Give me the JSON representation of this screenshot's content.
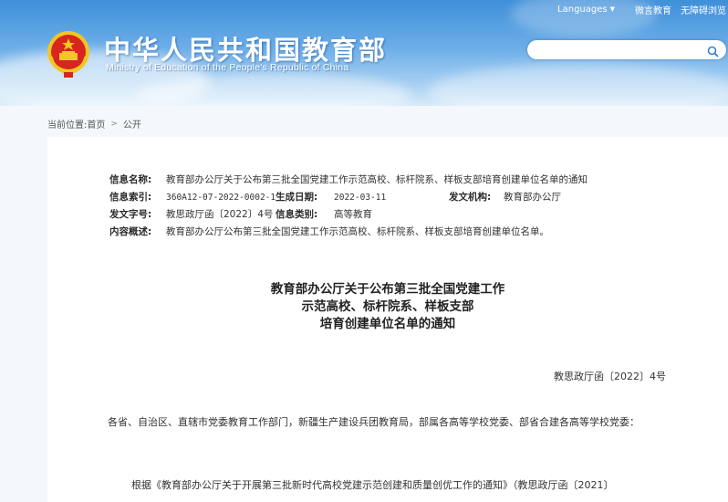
{
  "topbar": {
    "languages": "Languages",
    "weibo": "微言教育",
    "accessibility": "无障碍浏览"
  },
  "site": {
    "title_cn": "中华人民共和国教育部",
    "title_en": "Ministry of Education of the People's Republic of China"
  },
  "search": {
    "placeholder": ""
  },
  "breadcrumb": {
    "label": "当前位置:",
    "home": "首页",
    "current": "公开"
  },
  "info": {
    "name_label": "信息名称:",
    "name_value": "教育部办公厅关于公布第三批全国党建工作示范高校、标杆院系、样板支部培育创建单位名单的通知",
    "index_label": "信息索引:",
    "index_value": "360A12-07-2022-0002-1",
    "date_label": "生成日期:",
    "date_value": "2022-03-11",
    "org_label": "发文机构:",
    "org_value": "教育部办公厅",
    "docno_label": "发文字号:",
    "docno_value": "教思政厅函〔2022〕4号",
    "category_label": "信息类别:",
    "category_value": "高等教育",
    "summary_label": "内容概述:",
    "summary_value": "教育部办公厅公布第三批全国党建工作示范高校、标杆院系、样板支部培育创建单位名单。"
  },
  "document": {
    "title_line1": "教育部办公厅关于公布第三批全国党建工作",
    "title_line2": "示范高校、标杆院系、样板支部",
    "title_line3": "培育创建单位名单的通知",
    "doc_number": "教思政厅函〔2022〕4号",
    "addressee": "各省、自治区、直辖市党委教育工作部门，新疆生产建设兵团教育局，部属各高等学校党委、部省合建各高等学校党委：",
    "para1": "根据《教育部办公厅关于开展第三批新时代高校党建示范创建和质量创优工作的通知》（教思政厅函〔2021〕"
  },
  "colors": {
    "header_top": "#3f8fd9",
    "header_bottom": "#d8ebfa",
    "emblem_red": "#d7261e",
    "emblem_gold": "#f3c623"
  },
  "icons": {
    "emblem": "national-emblem-icon",
    "search": "search-icon",
    "chevron": "chevron-right-icon",
    "dropdown": "caret-down-icon"
  }
}
